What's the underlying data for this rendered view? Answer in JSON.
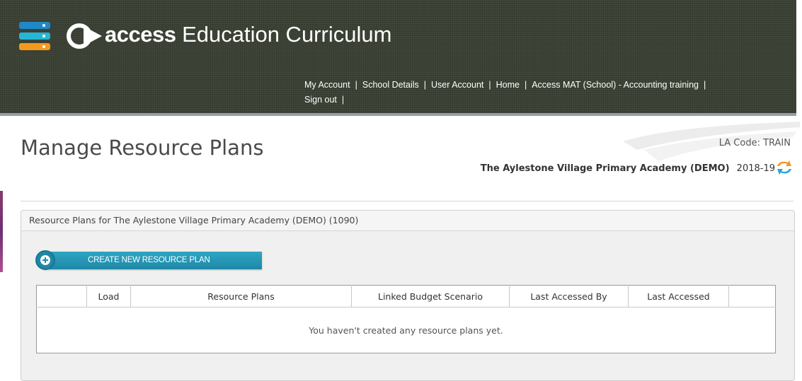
{
  "header": {
    "brand_bold": "access",
    "brand_light": " Education Curriculum",
    "nav": [
      "My Account",
      "School Details",
      "User Account",
      "Home",
      "Access MAT (School) - Accounting training",
      "Sign out"
    ],
    "nav_separator": "|",
    "menu_colors": [
      "#1e88c8",
      "#26b6d6",
      "#f39a1e"
    ]
  },
  "page": {
    "title": "Manage Resource Plans",
    "la_code": "LA Code: TRAIN",
    "school_name": "The Aylestone Village Primary Academy (DEMO)",
    "year": "2018-19",
    "refresh_icon": "refresh-arrows-icon"
  },
  "panel": {
    "title": "Resource Plans for The Aylestone Village Primary Academy (DEMO) (1090)",
    "create_button": "CREATE NEW RESOURCE PLAN"
  },
  "table": {
    "columns": [
      "",
      "Load",
      "Resource Plans",
      "Linked Budget Scenario",
      "Last Accessed By",
      "Last Accessed",
      ""
    ],
    "empty_message": "You haven't created any resource plans yet."
  },
  "colors": {
    "header_bg": "#3b4134",
    "button_accent": "#1e88a6",
    "refresh_orange": "#f39a1e",
    "refresh_blue": "#26a7d9"
  }
}
